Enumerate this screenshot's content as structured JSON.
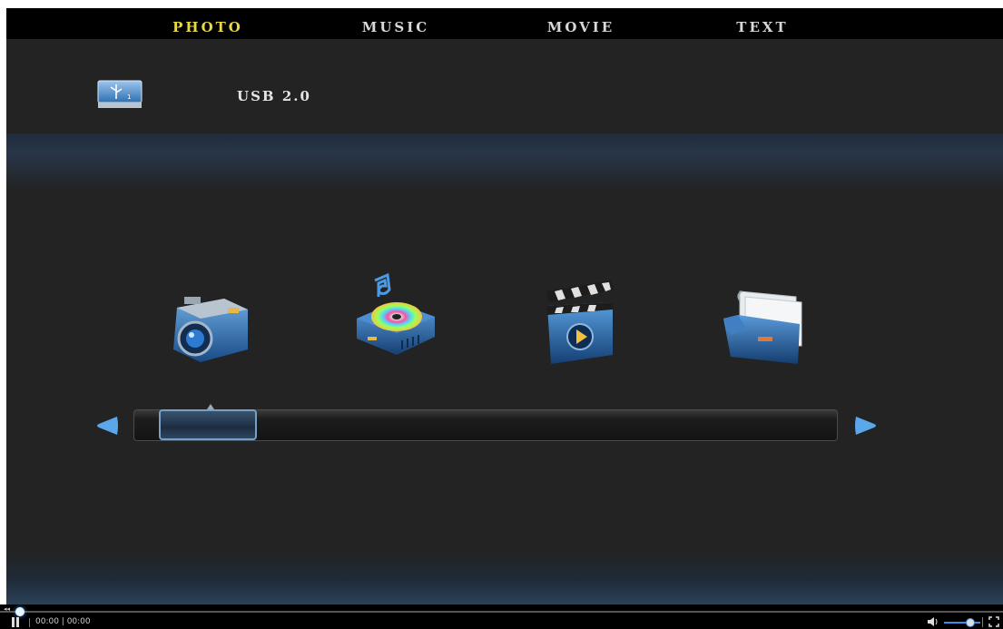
{
  "device": {
    "label": "USB 2.0",
    "icon": "usb-drive-icon"
  },
  "categories": [
    {
      "label": "PHOTO",
      "icon": "camera-icon",
      "selected": true
    },
    {
      "label": "MUSIC",
      "icon": "music-disc-icon",
      "selected": false
    },
    {
      "label": "MOVIE",
      "icon": "clapperboard-icon",
      "selected": false
    },
    {
      "label": "TEXT",
      "icon": "document-folder-icon",
      "selected": false
    }
  ],
  "player": {
    "time": "00:00 | 00:00",
    "progress": 0,
    "volume": 0.6
  },
  "colors": {
    "background": "#232323",
    "selected_text": "#e8d94a",
    "accent": "#3a8ee8"
  }
}
